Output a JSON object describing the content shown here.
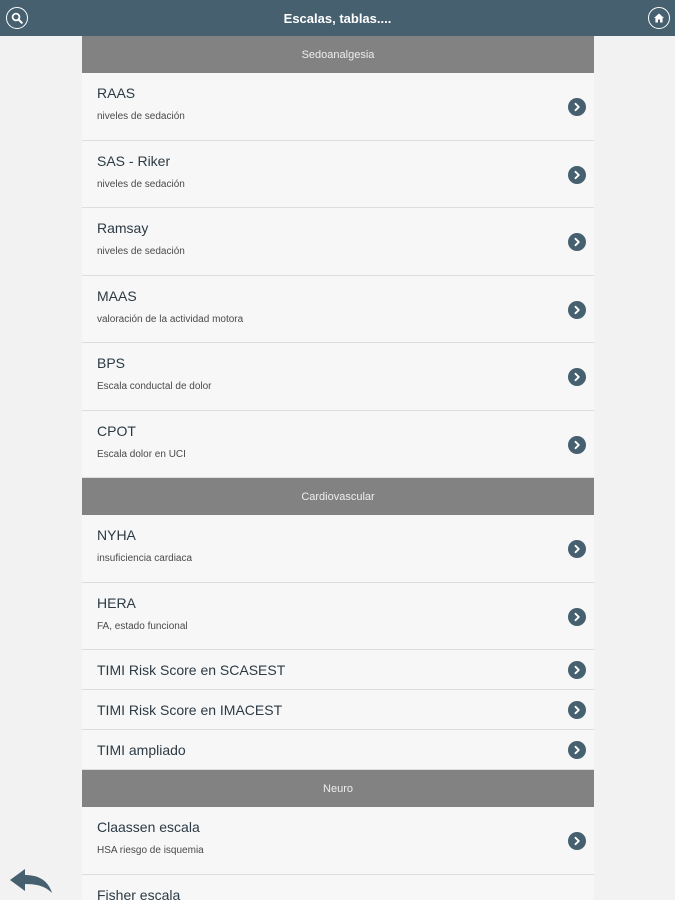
{
  "header": {
    "title": "Escalas, tablas....",
    "left_icon": "search-icon",
    "right_icon": "home-icon",
    "color": "#46606f"
  },
  "sections": [
    {
      "title": "Sedoanalgesia",
      "items": [
        {
          "title": "RAAS",
          "subtitle": "niveles de sedación"
        },
        {
          "title": "SAS - Riker",
          "subtitle": "niveles de sedación"
        },
        {
          "title": "Ramsay",
          "subtitle": "niveles de sedación"
        },
        {
          "title": "MAAS",
          "subtitle": "valoración de la actividad motora"
        },
        {
          "title": "BPS",
          "subtitle": "Escala conductal de dolor"
        },
        {
          "title": "CPOT",
          "subtitle": "Escala dolor en UCI"
        }
      ]
    },
    {
      "title": "Cardiovascular",
      "items": [
        {
          "title": "NYHA",
          "subtitle": "insuficiencia cardiaca"
        },
        {
          "title": "HERA",
          "subtitle": "FA, estado funcional"
        },
        {
          "title": "TIMI Risk Score en SCASEST",
          "subtitle": ""
        },
        {
          "title": "TIMI Risk Score en IMACEST",
          "subtitle": ""
        },
        {
          "title": "TIMI ampliado",
          "subtitle": ""
        }
      ]
    },
    {
      "title": "Neuro",
      "items": [
        {
          "title": "Claassen escala",
          "subtitle": "HSA riesgo de isquemia"
        },
        {
          "title": "Fisher escala",
          "subtitle": ""
        }
      ]
    }
  ],
  "footer": {
    "back_icon": "back-arrow-icon"
  }
}
